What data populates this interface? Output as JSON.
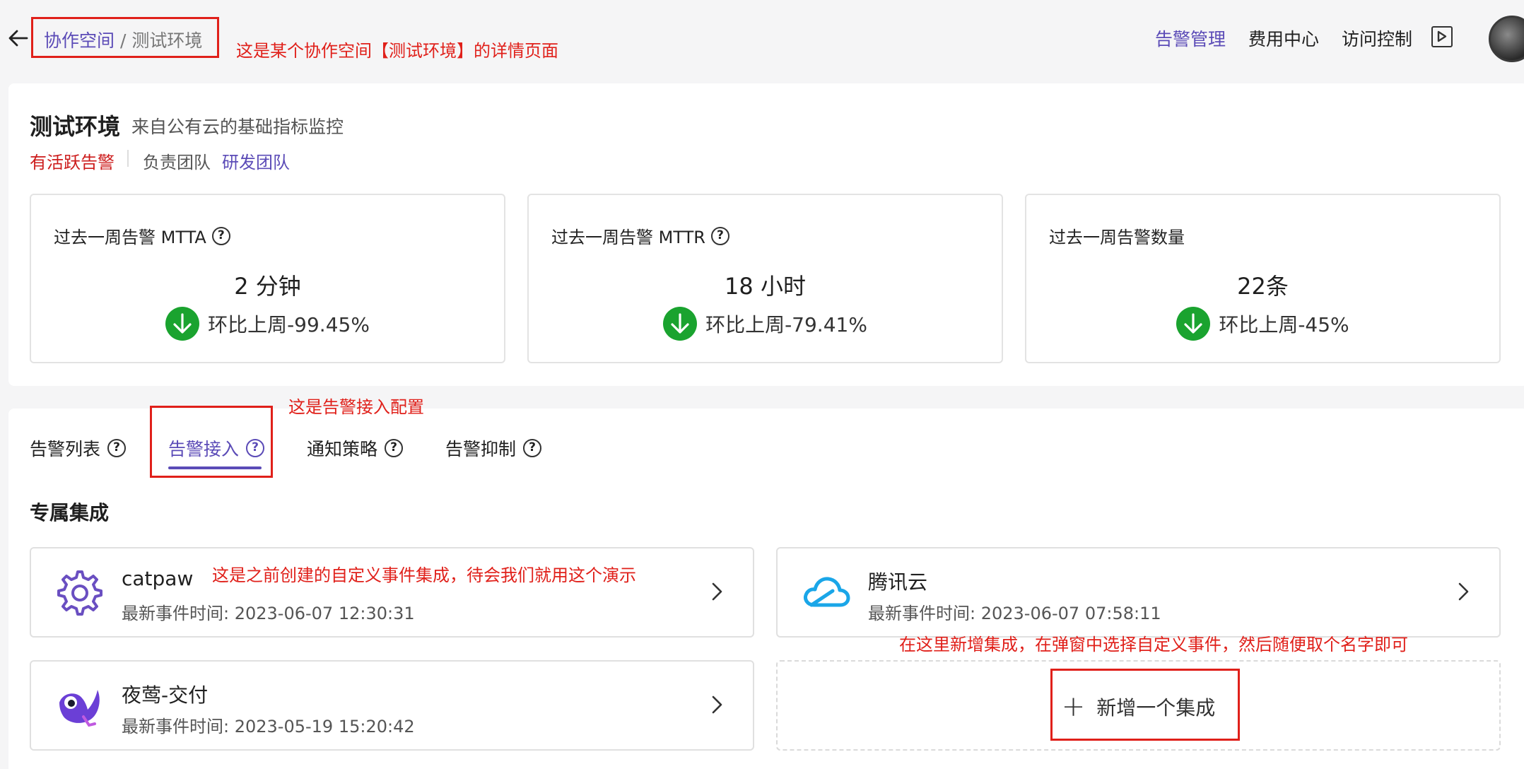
{
  "header": {
    "breadcrumb": {
      "parent": "协作空间",
      "separator": " / ",
      "current": "测试环境"
    },
    "nav": [
      "告警管理",
      "费用中心",
      "访问控制"
    ],
    "active_nav": "告警管理"
  },
  "annotations": {
    "page_note": "这是某个协作空间【测试环境】的详情页面",
    "tab_note": "这是告警接入配置",
    "catpaw_note": "这是之前创建的自定义事件集成，待会我们就用这个演示",
    "add_note": "在这里新增集成，在弹窗中选择自定义事件，然后随便取个名字即可"
  },
  "environment": {
    "title": "测试环境",
    "subtitle": "来自公有云的基础指标监控",
    "alert_status": "有活跃告警",
    "team_label": "负责团队",
    "team_name": "研发团队"
  },
  "stats": [
    {
      "label": "过去一周告警 MTTA",
      "has_help": true,
      "value": "2 分钟",
      "trend": "环比上周-99.45%"
    },
    {
      "label": "过去一周告警 MTTR",
      "has_help": true,
      "value": "18 小时",
      "trend": "环比上周-79.41%"
    },
    {
      "label": "过去一周告警数量",
      "has_help": false,
      "value": "22条",
      "trend": "环比上周-45%"
    }
  ],
  "tabs": [
    {
      "label": "告警列表"
    },
    {
      "label": "告警接入"
    },
    {
      "label": "通知策略"
    },
    {
      "label": "告警抑制"
    }
  ],
  "active_tab": "告警接入",
  "section_title": "专属集成",
  "integrations": [
    {
      "name": "catpaw",
      "time": "最新事件时间: 2023-06-07 12:30:31",
      "icon": "gear-icon"
    },
    {
      "name": "腾讯云",
      "time": "最新事件时间: 2023-06-07 07:58:11",
      "icon": "cloud-icon"
    },
    {
      "name": "夜莺-交付",
      "time": "最新事件时间: 2023-05-19 15:20:42",
      "icon": "nightingale-icon"
    }
  ],
  "add_integration_label": "新增一个集成",
  "colors": {
    "accent": "#5b4bb7",
    "alert": "#cc1b1b",
    "trend_down": "#1aa32f",
    "annotation": "#e0201a"
  }
}
